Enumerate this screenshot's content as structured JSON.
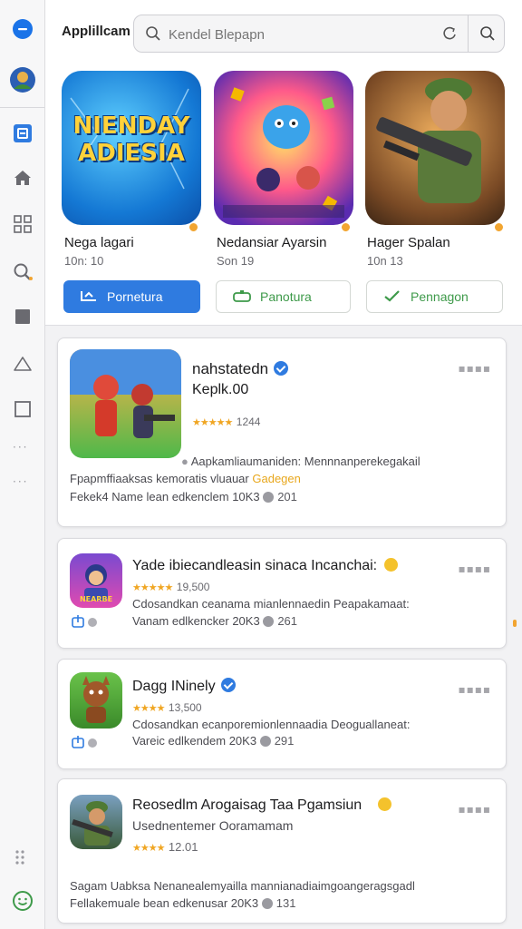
{
  "app": {
    "title": "Applillcam",
    "search": {
      "placeholder": "Kendel Blepapn"
    }
  },
  "rail": {
    "items": [
      {
        "name": "menu-icon"
      },
      {
        "name": "avatar"
      },
      {
        "name": "library-icon"
      },
      {
        "name": "home-icon"
      },
      {
        "name": "apps-icon"
      },
      {
        "name": "search-icon"
      },
      {
        "name": "stop-icon"
      },
      {
        "name": "alert-icon"
      },
      {
        "name": "window-icon"
      },
      {
        "name": "grid-icon"
      },
      {
        "name": "smiley-icon"
      }
    ]
  },
  "featured": [
    {
      "art_text": "NIENDAY ADIESIA",
      "title": "Nega lagari",
      "sub": "10n: 10",
      "button": "Pornetura",
      "style": "primary"
    },
    {
      "title": "Nedansiar Ayarsin",
      "sub": "Son 19",
      "button": "Panotura",
      "style": "outline"
    },
    {
      "title": "Hager Spalan",
      "sub": "10n 13",
      "button": "Pennagon",
      "style": "outline"
    }
  ],
  "cards": [
    {
      "name": "nahstatedn",
      "subtitle": "Keplk.00",
      "rating": "1244",
      "line1": "Aapkamliaumaniden: Mennnanperekegakail",
      "line2_prefix": "Fpapmffiaaksas kemoratis vluauar",
      "line2_highlight": "Gadegen",
      "line3": "Fekek4 Name lean edkenclem 10K3",
      "count": "201"
    },
    {
      "name": "Yade ibiecandleasin sinaca Incanchai:",
      "icon_label": "NEARBE",
      "rating": "19,500",
      "line1": "Cdosandkan ceanama mianlennaedin Peapakamaat:",
      "line2": "Vanam edlkencker 20K3",
      "count": "261"
    },
    {
      "name": "Dagg INinely",
      "rating": "13,500",
      "line1": "Cdosandkan ecanporemionlennaadia Deoguallaneat:",
      "line2": "Vareic edlkendem 20K3",
      "count": "291"
    },
    {
      "name": "Reosedlm Arogaisag Taa Pgamsiun",
      "subtitle": "Usednentemer Ooramamam",
      "rating": "12.01",
      "line1": "Sagam Uabksa Nenanealemyailla mannianadiaimgoangeragsgadl",
      "line2": "Fellakemuale bean edkenusar 20K3",
      "count": "131"
    }
  ],
  "colors": {
    "accent": "#2f7be0",
    "green": "#3e9a4a",
    "star": "#f0a623"
  }
}
